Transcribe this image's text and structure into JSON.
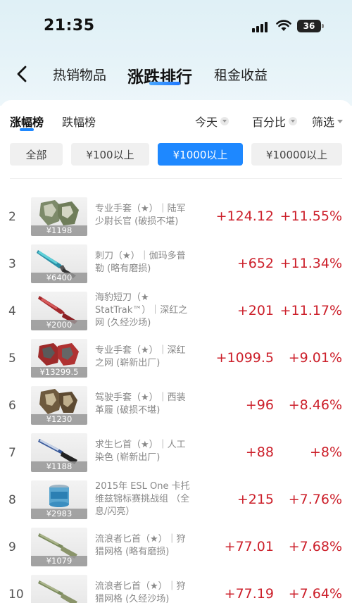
{
  "status": {
    "time": "21:35",
    "battery": "36"
  },
  "nav": {
    "tabs": [
      "热销物品",
      "涨跌排行",
      "租金收益"
    ],
    "active_tab": "涨跌排行"
  },
  "sub_tabs": {
    "tabs": [
      "涨幅榜",
      "跌幅榜"
    ],
    "active": "涨幅榜"
  },
  "filters": {
    "period": "今天",
    "mode": "百分比",
    "filter": "筛选"
  },
  "price_filters": {
    "options": [
      "全部",
      "¥100以上",
      "¥1000以上",
      "¥10000以上"
    ],
    "active": "¥1000以上"
  },
  "colors": {
    "accent": "#1e88ff",
    "rise": "#cc1f2a"
  },
  "items": [
    {
      "rank": "2",
      "price": "¥1198",
      "name": "专业手套（★）｜陆军少尉长官 (破损不堪)",
      "change": "+124.12",
      "pct": "+11.55%",
      "icon": "gloves-green-icon"
    },
    {
      "rank": "3",
      "price": "¥6400",
      "name": "刺刀（★）｜伽玛多普勒 (略有磨损)",
      "change": "+652",
      "pct": "+11.34%",
      "icon": "bayonet-icon"
    },
    {
      "rank": "4",
      "price": "¥2000",
      "name": "海豹短刀（★ StatTrak™）｜深红之网 (久经沙场)",
      "change": "+201",
      "pct": "+11.17%",
      "icon": "bowie-knife-red-icon"
    },
    {
      "rank": "5",
      "price": "¥13299.5",
      "name": "专业手套（★）｜深红之网 (崭新出厂)",
      "change": "+1099.5",
      "pct": "+9.01%",
      "icon": "gloves-red-icon"
    },
    {
      "rank": "6",
      "price": "¥1230",
      "name": "驾驶手套（★）｜西装革履 (破损不堪)",
      "change": "+96",
      "pct": "+8.46%",
      "icon": "driver-gloves-icon"
    },
    {
      "rank": "7",
      "price": "¥1188",
      "name": "求生匕首（★）｜人工染色 (崭新出厂)",
      "change": "+88",
      "pct": "+8%",
      "icon": "survival-knife-icon"
    },
    {
      "rank": "8",
      "price": "¥2983",
      "name": "2015年 ESL One 卡托维兹锦标赛挑战组 （全息/闪亮）",
      "change": "+215",
      "pct": "+7.76%",
      "icon": "sticker-capsule-icon"
    },
    {
      "rank": "9",
      "price": "¥1079",
      "name": "流浪者匕首（★）｜狩猎网格 (略有磨损)",
      "change": "+77.01",
      "pct": "+7.68%",
      "icon": "nomad-knife-icon"
    },
    {
      "rank": "10",
      "price": "",
      "name": "流浪者匕首（★）｜狩猎网格 (久经沙场)",
      "change": "+77.19",
      "pct": "+7.64%",
      "icon": "nomad-knife-icon"
    }
  ]
}
